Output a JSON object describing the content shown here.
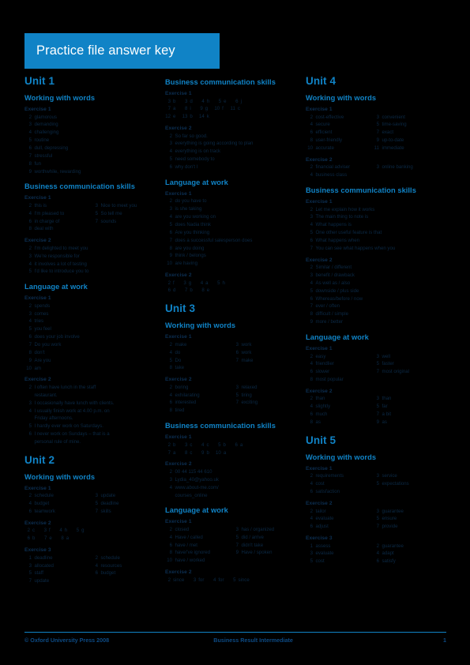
{
  "header": {
    "title": "Practice file answer key",
    "banner_color": "#1083c6"
  },
  "footer": {
    "copyright": "© Oxford University Press 2008",
    "book": "Business Result Intermediate",
    "page_number": "1"
  },
  "labels": {
    "working_with_words": "Working with words",
    "business_communication_skills": "Business communication skills",
    "language_at_work": "Language at work",
    "exercise1": "Exercise 1",
    "exercise2": "Exercise 2",
    "exercise3": "Exercise 3"
  },
  "units": {
    "unit1": {
      "title": "Unit 1",
      "www": {
        "ex1": [
          {
            "n": "2",
            "t": "glamorous"
          },
          {
            "n": "3",
            "t": "demanding"
          },
          {
            "n": "4",
            "t": "challenging"
          },
          {
            "n": "5",
            "t": "routine"
          },
          {
            "n": "6",
            "t": "dull, depressing"
          },
          {
            "n": "7",
            "t": "stressful"
          },
          {
            "n": "8",
            "t": "fun"
          },
          {
            "n": "9",
            "t": "worthwhile, rewarding"
          }
        ]
      },
      "bcs": {
        "ex1_left": [
          {
            "n": "2",
            "t": "this is"
          },
          {
            "n": "4",
            "t": "I'm pleased to"
          },
          {
            "n": "6",
            "t": "in charge of"
          },
          {
            "n": "8",
            "t": "deal with"
          }
        ],
        "ex1_right": [
          {
            "n": "3",
            "t": "Nice to meet you"
          },
          {
            "n": "5",
            "t": "So tell me"
          },
          {
            "n": "7",
            "t": "sounds"
          }
        ],
        "ex2": [
          {
            "n": "2",
            "t": "I'm delighted to meet you"
          },
          {
            "n": "3",
            "t": "We're responsible for"
          },
          {
            "n": "4",
            "t": "it involves a lot of testing"
          },
          {
            "n": "5",
            "t": "I'd like to introduce you to"
          }
        ]
      },
      "law": {
        "ex1": [
          {
            "n": "2",
            "t": "spends"
          },
          {
            "n": "3",
            "t": "comes"
          },
          {
            "n": "4",
            "t": "tries"
          },
          {
            "n": "5",
            "t": "you feel"
          },
          {
            "n": "6",
            "t": "does your job involve"
          },
          {
            "n": "7",
            "t": "Do you work"
          },
          {
            "n": "8",
            "t": "don't"
          },
          {
            "n": "9",
            "t": "Are you"
          },
          {
            "n": "10",
            "t": "am"
          }
        ],
        "ex2": [
          {
            "n": "2",
            "t": "I often have lunch in the staff",
            "c": "restaurant."
          },
          {
            "n": "3",
            "t": "I occasionally have lunch with clients."
          },
          {
            "n": "4",
            "t": "I usually finish work at 4.00 p.m. on",
            "c": "Friday afternoons."
          },
          {
            "n": "5",
            "t": "I hardly ever work on Saturdays."
          },
          {
            "n": "6",
            "t": "I never work on Sundays – that is a",
            "c": "personal rule of mine."
          }
        ]
      }
    },
    "unit2": {
      "title": "Unit 2",
      "www": {
        "ex1_left": [
          {
            "n": "2",
            "t": "schedule"
          },
          {
            "n": "4",
            "t": "budget"
          },
          {
            "n": "6",
            "t": "teamwork"
          }
        ],
        "ex1_right": [
          {
            "n": "3",
            "t": "update"
          },
          {
            "n": "5",
            "t": "deadline"
          },
          {
            "n": "7",
            "t": "skills"
          }
        ],
        "ex2_row1": [
          {
            "n": "2",
            "t": "c"
          },
          {
            "n": "3",
            "t": "f"
          },
          {
            "n": "4",
            "t": "h"
          },
          {
            "n": "5",
            "t": "g"
          }
        ],
        "ex2_row2": [
          {
            "n": "6",
            "t": "b"
          },
          {
            "n": "7",
            "t": "e"
          },
          {
            "n": "8",
            "t": "a"
          }
        ],
        "ex3_left": [
          {
            "n": "1",
            "t": "deadline"
          },
          {
            "n": "3",
            "t": "allocated"
          },
          {
            "n": "5",
            "t": "staff"
          },
          {
            "n": "7",
            "t": "update"
          }
        ],
        "ex3_right": [
          {
            "n": "2",
            "t": "schedule"
          },
          {
            "n": "4",
            "t": "resources"
          },
          {
            "n": "6",
            "t": "budget"
          }
        ]
      }
    },
    "unit3": {
      "title": "Unit 3",
      "www": {
        "ex1_left": [
          {
            "n": "2",
            "t": "make"
          },
          {
            "n": "4",
            "t": "do"
          },
          {
            "n": "5",
            "t": "Do"
          },
          {
            "n": "8",
            "t": "take"
          }
        ],
        "ex1_right": [
          {
            "n": "3",
            "t": "work"
          },
          {
            "n": "6",
            "t": "work"
          },
          {
            "n": "7",
            "t": "make"
          }
        ],
        "ex2_left": [
          {
            "n": "2",
            "t": "boring"
          },
          {
            "n": "4",
            "t": "exhilarating"
          },
          {
            "n": "6",
            "t": "interested"
          },
          {
            "n": "8",
            "t": "tired"
          }
        ],
        "ex2_right": [
          {
            "n": "3",
            "t": "relaxed"
          },
          {
            "n": "5",
            "t": "tiring"
          },
          {
            "n": "7",
            "t": "exciting"
          }
        ]
      },
      "bcs": {
        "ex1_row1": [
          {
            "n": "2",
            "t": "b"
          },
          {
            "n": "3",
            "t": "c"
          },
          {
            "n": "4",
            "t": "c"
          },
          {
            "n": "5",
            "t": "b"
          },
          {
            "n": "6",
            "t": "a"
          }
        ],
        "ex1_row2": [
          {
            "n": "7",
            "t": "a"
          },
          {
            "n": "8",
            "t": "c"
          },
          {
            "n": "9",
            "t": "b"
          },
          {
            "n": "10",
            "t": "a"
          }
        ],
        "ex2": [
          {
            "n": "2",
            "t": "00 44 115 44 610"
          },
          {
            "n": "3",
            "t": "Lydia_40@yahoo.uk"
          },
          {
            "n": "4",
            "t": "www.about-me.com/",
            "c": "courses_online"
          }
        ]
      },
      "law": {
        "ex1_left": [
          {
            "n": "2",
            "t": "closed"
          },
          {
            "n": "4",
            "t": "Have / called"
          },
          {
            "n": "6",
            "t": "have / met"
          },
          {
            "n": "8",
            "t": "have/'ve ignored"
          },
          {
            "n": "10",
            "t": "have / worked"
          }
        ],
        "ex1_right": [
          {
            "n": "3",
            "t": "has / organized"
          },
          {
            "n": "5",
            "t": "did / arrive"
          },
          {
            "n": "7",
            "t": "didn't take"
          },
          {
            "n": "9",
            "t": "Have / spoken"
          }
        ],
        "ex2_row": [
          {
            "n": "2",
            "t": "since"
          },
          {
            "n": "3",
            "t": "for"
          },
          {
            "n": "4",
            "t": "for"
          },
          {
            "n": "5",
            "t": "since"
          }
        ]
      }
    },
    "unit4": {
      "title": "Unit 4",
      "www": {
        "ex1_left": [
          {
            "n": "2",
            "t": "cost-effective"
          },
          {
            "n": "4",
            "t": "secure"
          },
          {
            "n": "6",
            "t": "efficient"
          },
          {
            "n": "8",
            "t": "user-friendly"
          },
          {
            "n": "10",
            "t": "accurate"
          }
        ],
        "ex1_right": [
          {
            "n": "3",
            "t": "convenient"
          },
          {
            "n": "5",
            "t": "time-saving"
          },
          {
            "n": "7",
            "t": "exact"
          },
          {
            "n": "9",
            "t": "up-to-date"
          },
          {
            "n": "11",
            "t": "immediate"
          }
        ],
        "ex2_left": [
          {
            "n": "2",
            "t": "financial adviser"
          },
          {
            "n": "4",
            "t": "business class"
          }
        ],
        "ex2_right": [
          {
            "n": "3",
            "t": "online banking"
          }
        ]
      },
      "bcs": {
        "ex1": [
          {
            "n": "2",
            "t": "Let me explain how it works"
          },
          {
            "n": "3",
            "t": "The main thing to note is"
          },
          {
            "n": "4",
            "t": "What happens is"
          },
          {
            "n": "5",
            "t": "One other useful feature is that"
          },
          {
            "n": "6",
            "t": "What happens when"
          },
          {
            "n": "7",
            "t": "You can see what happens when you"
          }
        ],
        "ex2": [
          {
            "n": "2",
            "t": "Similar / different"
          },
          {
            "n": "3",
            "t": "benefit / drawback"
          },
          {
            "n": "4",
            "t": "As well as / also"
          },
          {
            "n": "5",
            "t": "downside / plus side"
          },
          {
            "n": "6",
            "t": "Whereas/before / now"
          },
          {
            "n": "7",
            "t": "ever / often"
          },
          {
            "n": "8",
            "t": "difficult / simple"
          },
          {
            "n": "9",
            "t": "more / better"
          }
        ]
      },
      "law": {
        "ex1_left": [
          {
            "n": "2",
            "t": "easy"
          },
          {
            "n": "4",
            "t": "friendlier"
          },
          {
            "n": "6",
            "t": "slower"
          },
          {
            "n": "8",
            "t": "most popular"
          }
        ],
        "ex1_right": [
          {
            "n": "3",
            "t": "well"
          },
          {
            "n": "5",
            "t": "faster"
          },
          {
            "n": "7",
            "t": "most original"
          }
        ],
        "ex2_left": [
          {
            "n": "2",
            "t": "than"
          },
          {
            "n": "4",
            "t": "slightly"
          },
          {
            "n": "6",
            "t": "much"
          },
          {
            "n": "8",
            "t": "as"
          }
        ],
        "ex2_right": [
          {
            "n": "3",
            "t": "than"
          },
          {
            "n": "5",
            "t": "far"
          },
          {
            "n": "7",
            "t": "a bit"
          },
          {
            "n": "9",
            "t": "as"
          }
        ]
      }
    },
    "unit5": {
      "title": "Unit 5",
      "www": {
        "ex1_left": [
          {
            "n": "2",
            "t": "requirements"
          },
          {
            "n": "4",
            "t": "cost"
          },
          {
            "n": "6",
            "t": "satisfaction"
          }
        ],
        "ex1_right": [
          {
            "n": "3",
            "t": "service"
          },
          {
            "n": "5",
            "t": "expectations"
          }
        ],
        "ex2_left": [
          {
            "n": "2",
            "t": "tailor"
          },
          {
            "n": "4",
            "t": "evaluate"
          },
          {
            "n": "6",
            "t": "adjust"
          }
        ],
        "ex2_right": [
          {
            "n": "3",
            "t": "guarantee"
          },
          {
            "n": "5",
            "t": "ensure"
          },
          {
            "n": "7",
            "t": "provide"
          }
        ],
        "ex3_left": [
          {
            "n": "1",
            "t": "assess"
          },
          {
            "n": "3",
            "t": "evaluate"
          },
          {
            "n": "5",
            "t": "cost"
          }
        ],
        "ex3_right": [
          {
            "n": "2",
            "t": "guarantee"
          },
          {
            "n": "4",
            "t": "adapt"
          },
          {
            "n": "6",
            "t": "satisfy"
          }
        ]
      }
    }
  }
}
